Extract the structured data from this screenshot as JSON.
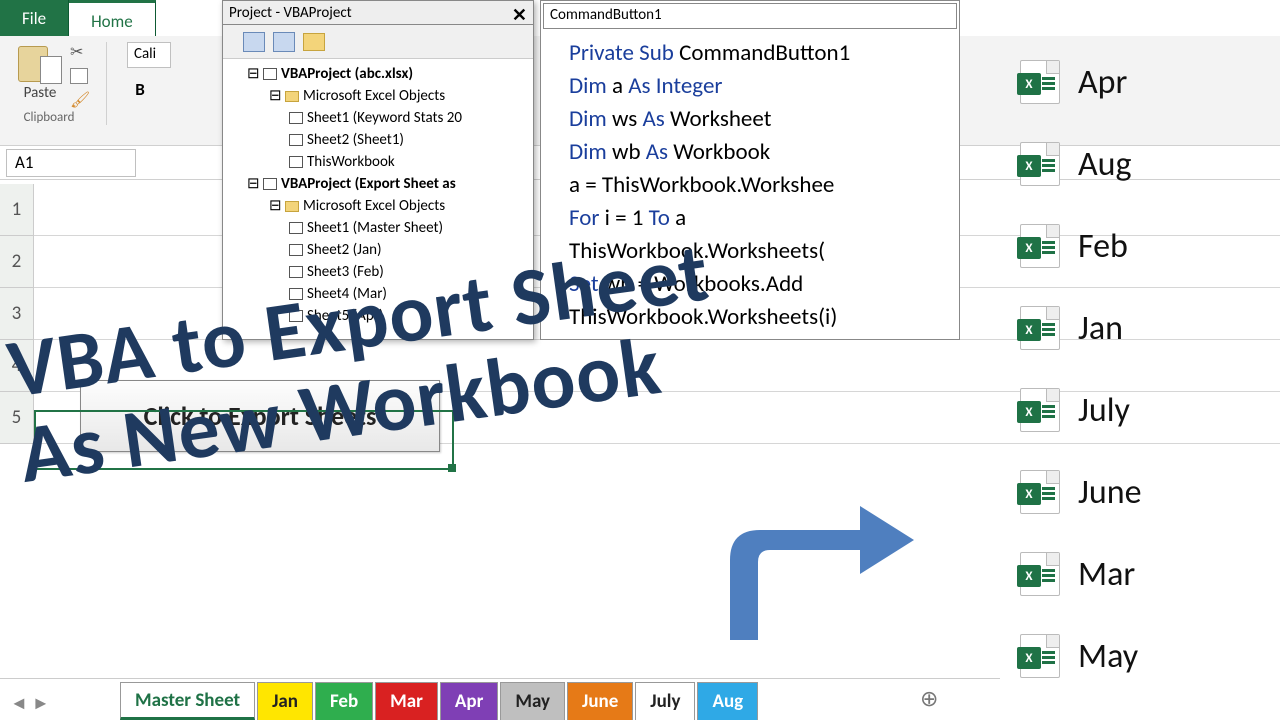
{
  "ribbon": {
    "tabs": [
      "File",
      "Home"
    ],
    "paste_label": "Paste",
    "clipboard_label": "Clipboard",
    "font_hint": "Cali",
    "bold": "B"
  },
  "namebox": "A1",
  "vbe_project": {
    "title": "Project - VBAProject",
    "nodes": [
      {
        "lvl": 1,
        "bold": true,
        "text": "VBAProject (abc.xlsx)"
      },
      {
        "lvl": 2,
        "text": "Microsoft Excel Objects"
      },
      {
        "lvl": 3,
        "text": "Sheet1 (Keyword Stats 20"
      },
      {
        "lvl": 3,
        "text": "Sheet2 (Sheet1)"
      },
      {
        "lvl": 3,
        "text": "ThisWorkbook"
      },
      {
        "lvl": 1,
        "bold": true,
        "text": "VBAProject (Export Sheet as"
      },
      {
        "lvl": 2,
        "text": "Microsoft Excel Objects"
      },
      {
        "lvl": 3,
        "text": "Sheet1 (Master Sheet)"
      },
      {
        "lvl": 3,
        "text": "Sheet2 (Jan)"
      },
      {
        "lvl": 3,
        "text": "Sheet3 (Feb)"
      },
      {
        "lvl": 3,
        "text": "Sheet4 (Mar)"
      },
      {
        "lvl": 3,
        "text": "Sheet5 (Apr)"
      }
    ]
  },
  "vbe_code": {
    "combo": "CommandButton1",
    "lines": [
      [
        {
          "k": true,
          "t": "Private Sub"
        },
        {
          "t": " CommandButton1"
        }
      ],
      [
        {
          "k": true,
          "t": "Dim"
        },
        {
          "t": " a "
        },
        {
          "k": true,
          "t": "As Integer"
        }
      ],
      [
        {
          "k": true,
          "t": "Dim"
        },
        {
          "t": " ws "
        },
        {
          "k": true,
          "t": "As"
        },
        {
          "t": " Worksheet"
        }
      ],
      [
        {
          "k": true,
          "t": "Dim"
        },
        {
          "t": " wb "
        },
        {
          "k": true,
          "t": "As"
        },
        {
          "t": " Workbook"
        }
      ],
      [
        {
          "t": "a = ThisWorkbook.Workshee"
        }
      ],
      [
        {
          "k": true,
          "t": "For"
        },
        {
          "t": " i = 1 "
        },
        {
          "k": true,
          "t": "To"
        },
        {
          "t": " a"
        }
      ],
      [
        {
          "t": "ThisWorkbook.Worksheets("
        }
      ],
      [
        {
          "k": true,
          "t": "Set"
        },
        {
          "t": " wb = Workbooks.Add"
        }
      ],
      [
        {
          "t": "ThisWorkbook.Worksheets(i)"
        }
      ]
    ]
  },
  "export_button": "Click to Export Sheets",
  "rows": [
    "1",
    "2",
    "3",
    "4",
    "5"
  ],
  "sheet_tabs": [
    {
      "label": "Master Sheet",
      "bg": "#ffffff",
      "active": true
    },
    {
      "label": "Jan",
      "bg": "#ffe600"
    },
    {
      "label": "Feb",
      "bg": "#2fae4e",
      "fg": "#fff"
    },
    {
      "label": "Mar",
      "bg": "#d92121",
      "fg": "#fff"
    },
    {
      "label": "Apr",
      "bg": "#7f3fb5",
      "fg": "#fff"
    },
    {
      "label": "May",
      "bg": "#bfbfbf"
    },
    {
      "label": "June",
      "bg": "#e67a17",
      "fg": "#fff"
    },
    {
      "label": "July",
      "bg": "#ffffff"
    },
    {
      "label": "Aug",
      "bg": "#2fa9e6",
      "fg": "#fff"
    }
  ],
  "files": [
    "Apr",
    "Aug",
    "Feb",
    "Jan",
    "July",
    "June",
    "Mar",
    "May"
  ],
  "overlay": {
    "line1": "VBA to Export Sheet",
    "line2": "As New Workbook"
  },
  "tab_plus": "⊕"
}
